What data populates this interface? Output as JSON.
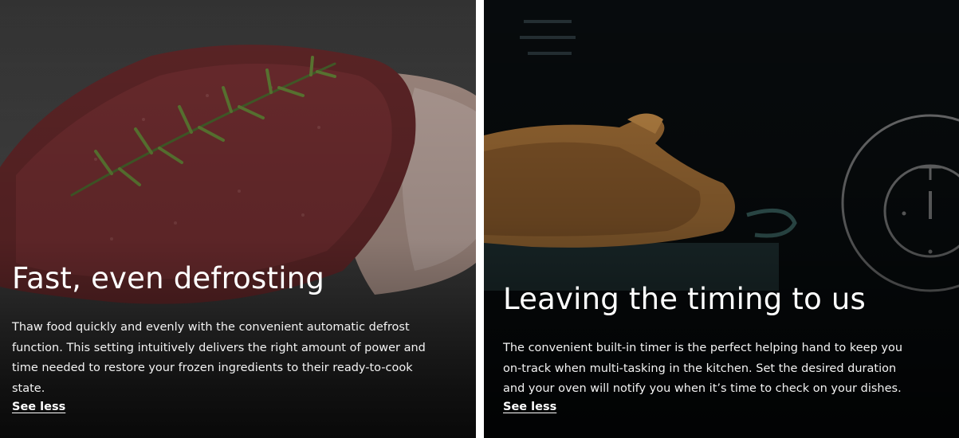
{
  "cards": [
    {
      "title": "Fast, even defrosting",
      "body": "Thaw food quickly and evenly with the convenient automatic defrost function. This setting intuitively delivers the right amount of power and time needed to restore your frozen ingredients to their ready-to-cook state.",
      "link": "See less",
      "image": "defrosting-meat-with-rosemary"
    },
    {
      "title": "Leaving the timing to us",
      "body": "The convenient built-in timer is the perfect helping hand to keep you on-track when multi-tasking in the kitchen. Set the desired duration and your oven will notify you when it’s time to check on your dishes.",
      "link": "See less",
      "image": "roast-chicken-in-oven",
      "icon": "timer-icon"
    }
  ]
}
